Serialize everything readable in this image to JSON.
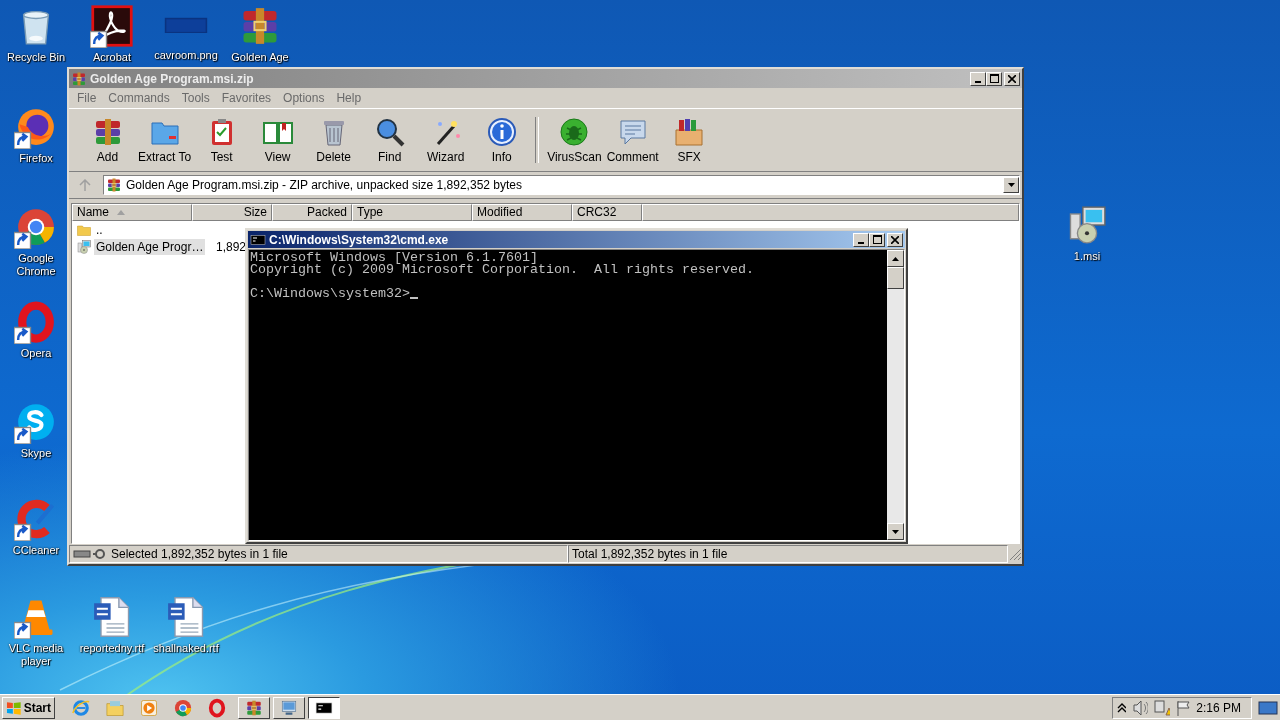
{
  "desktop": {
    "icons": [
      {
        "label": "Recycle Bin",
        "kind": "recycle",
        "shortcut": false
      },
      {
        "label": "Acrobat",
        "kind": "acrobat",
        "shortcut": true
      },
      {
        "label": "cavroom.png",
        "kind": "image",
        "shortcut": false
      },
      {
        "label": "Golden Age",
        "kind": "winrar",
        "shortcut": false
      },
      {
        "label": "Firefox",
        "kind": "firefox",
        "shortcut": true
      },
      {
        "label": "Google Chrome",
        "kind": "chrome",
        "shortcut": true
      },
      {
        "label": "Opera",
        "kind": "opera",
        "shortcut": true
      },
      {
        "label": "Skype",
        "kind": "skype",
        "shortcut": true
      },
      {
        "label": "CCleaner",
        "kind": "ccleaner",
        "shortcut": true
      },
      {
        "label": "VLC media player",
        "kind": "vlc",
        "shortcut": true
      },
      {
        "label": "reportedny.rtf",
        "kind": "word",
        "shortcut": false
      },
      {
        "label": "shallnaked.rtf",
        "kind": "word",
        "shortcut": false
      },
      {
        "label": "1.msi",
        "kind": "msi",
        "shortcut": false
      }
    ]
  },
  "winrar": {
    "title": "Golden Age Program.msi.zip",
    "menu": [
      "File",
      "Commands",
      "Tools",
      "Favorites",
      "Options",
      "Help"
    ],
    "toolbar": [
      {
        "label": "Add",
        "kind": "add",
        "separated": false
      },
      {
        "label": "Extract To",
        "kind": "extract",
        "separated": false
      },
      {
        "label": "Test",
        "kind": "test",
        "separated": false
      },
      {
        "label": "View",
        "kind": "view",
        "separated": false
      },
      {
        "label": "Delete",
        "kind": "delete",
        "separated": false
      },
      {
        "label": "Find",
        "kind": "find",
        "separated": false
      },
      {
        "label": "Wizard",
        "kind": "wizard",
        "separated": false
      },
      {
        "label": "Info",
        "kind": "info",
        "separated": false
      },
      {
        "label": "VirusScan",
        "kind": "virusscan",
        "separated": true
      },
      {
        "label": "Comment",
        "kind": "comment",
        "separated": false
      },
      {
        "label": "SFX",
        "kind": "sfx",
        "separated": false
      }
    ],
    "address": "Golden Age Program.msi.zip - ZIP archive, unpacked size 1,892,352 bytes",
    "columns": [
      {
        "label": "Name",
        "sorted": true
      },
      {
        "label": "Size",
        "sorted": false
      },
      {
        "label": "Packed",
        "sorted": false
      },
      {
        "label": "Type",
        "sorted": false
      },
      {
        "label": "Modified",
        "sorted": false
      },
      {
        "label": "CRC32",
        "sorted": false
      }
    ],
    "rows": [
      {
        "name": "..",
        "kind": "folder",
        "selected": false
      },
      {
        "name": "Golden Age Progr…",
        "size": "1,892",
        "kind": "msi",
        "selected": true
      }
    ],
    "status": {
      "selection": "Selected 1,892,352 bytes in 1 file",
      "total": "Total 1,892,352 bytes in 1 file"
    }
  },
  "cmd": {
    "title": "C:\\Windows\\System32\\cmd.exe",
    "output": [
      "Microsoft Windows [Version 6.1.7601]",
      "Copyright (c) 2009 Microsoft Corporation.  All rights reserved."
    ],
    "prompt": "C:\\Windows\\system32>"
  },
  "taskbar": {
    "start": "Start",
    "tasks": [
      {
        "kind": "winrar",
        "selected": false
      },
      {
        "kind": "remote",
        "selected": false
      },
      {
        "kind": "cmd",
        "selected": true
      }
    ],
    "clock": "2:16 PM"
  }
}
